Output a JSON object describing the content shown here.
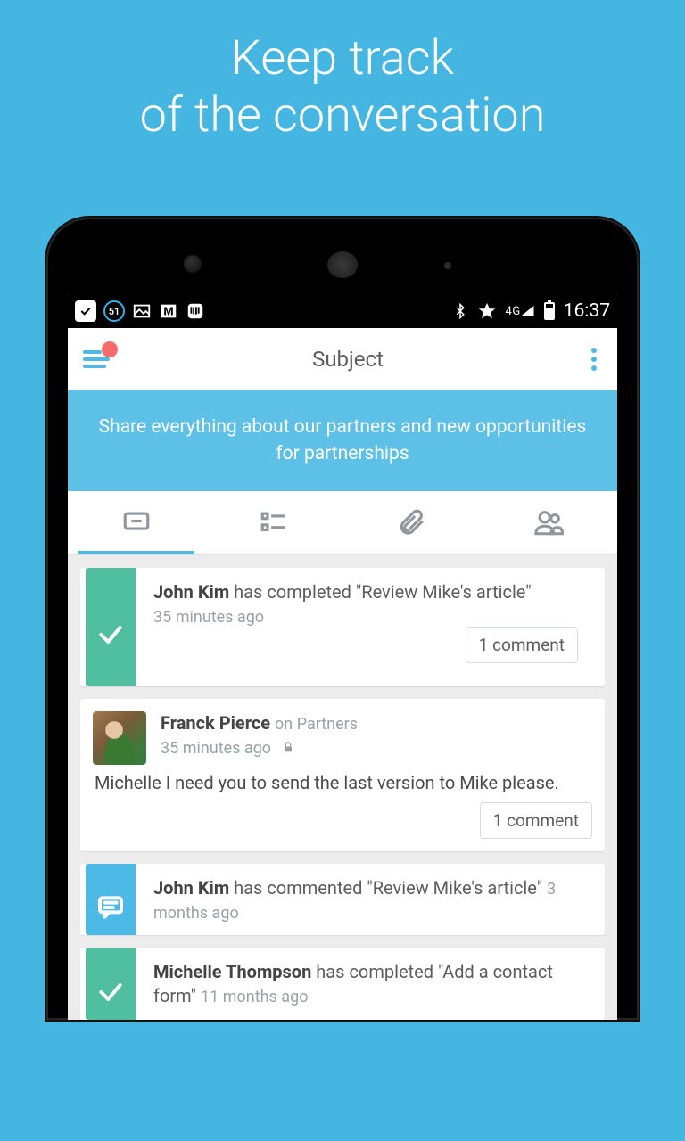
{
  "hero": {
    "line1": "Keep track",
    "line2": "of the conversation"
  },
  "statusbar": {
    "badge_count": "51",
    "network_label": "4G",
    "time": "16:37"
  },
  "appbar": {
    "title": "Subject"
  },
  "banner": {
    "text": "Share everything about our partners and new opportunities for partnerships"
  },
  "tabs": [
    "feed",
    "tasks",
    "attachments",
    "people"
  ],
  "feed": [
    {
      "type": "completed",
      "actor": "John Kim",
      "action": "has completed \"Review Mike's article\"",
      "time": "35 minutes ago",
      "comments_label": "1 comment"
    },
    {
      "type": "post",
      "actor": "Franck Pierce",
      "context": "on Partners",
      "time": "35 minutes ago",
      "locked": true,
      "message": "Michelle I need you to send the last version to Mike please.",
      "comments_label": "1 comment"
    },
    {
      "type": "comment",
      "actor": "John Kim",
      "action": "has commented \"Review Mike's article\"",
      "time": "3 months ago"
    },
    {
      "type": "completed",
      "actor": "Michelle Thompson",
      "action": "has completed \"Add a contact form\"",
      "time": "11 months ago"
    }
  ],
  "colors": {
    "accent": "#4cb9e6",
    "green": "#4fbf9f",
    "notif": "#f86b6b"
  }
}
